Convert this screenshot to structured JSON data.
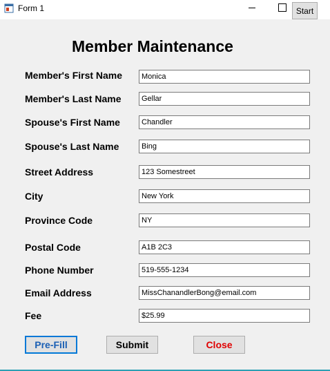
{
  "window": {
    "title": "Form 1",
    "start_label": "Start"
  },
  "heading": "Member Maintenance",
  "fields": [
    {
      "label": "Member's First Name",
      "value": "Monica"
    },
    {
      "label": "Member's Last Name",
      "value": "Gellar"
    },
    {
      "label": "Spouse's First Name",
      "value": "Chandler"
    },
    {
      "label": "Spouse's Last Name",
      "value": "Bing"
    },
    {
      "label": "Street Address",
      "value": "123 Somestreet"
    },
    {
      "label": "City",
      "value": "New York"
    },
    {
      "label": "Province Code",
      "value": "NY"
    },
    {
      "label": "Postal Code",
      "value": "A1B 2C3"
    },
    {
      "label": "Phone Number",
      "value": "519-555-1234"
    },
    {
      "label": "Email Address",
      "value": "MissChanandlerBong@email.com"
    },
    {
      "label": "Fee",
      "value": "$25.99"
    }
  ],
  "buttons": {
    "prefill": "Pre-Fill",
    "submit": "Submit",
    "close": "Close"
  },
  "colors": {
    "accent": "#0078d7",
    "close_text": "#e00000"
  }
}
